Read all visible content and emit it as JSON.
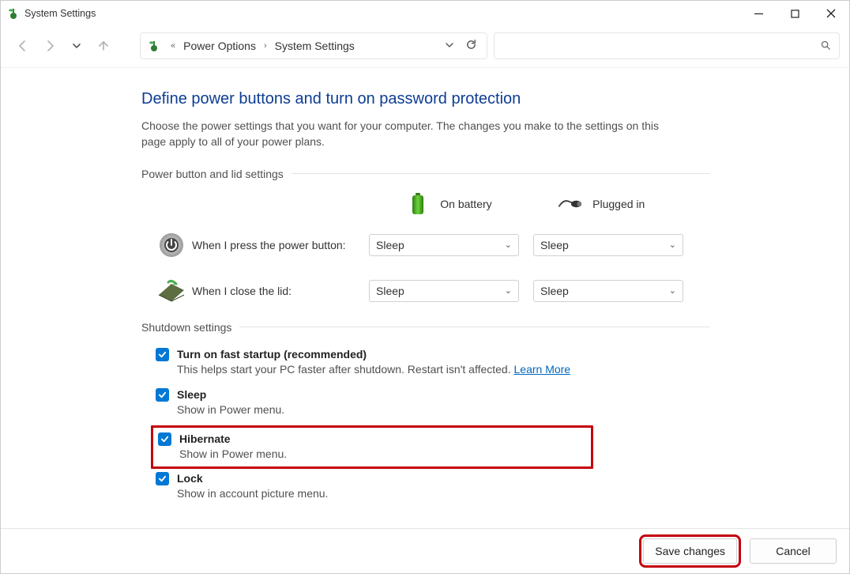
{
  "titlebar": {
    "title": "System Settings"
  },
  "breadcrumb": {
    "parent": "Power Options",
    "current": "System Settings"
  },
  "page": {
    "title": "Define power buttons and turn on password protection",
    "subtitle": "Choose the power settings that you want for your computer. The changes you make to the settings on this page apply to all of your power plans."
  },
  "power_section": {
    "header": "Power button and lid settings",
    "col_battery": "On battery",
    "col_plugged": "Plugged in",
    "rows": {
      "power_button": {
        "label": "When I press the power button:",
        "battery_value": "Sleep",
        "plugged_value": "Sleep"
      },
      "lid": {
        "label": "When I close the lid:",
        "battery_value": "Sleep",
        "plugged_value": "Sleep"
      }
    }
  },
  "shutdown_section": {
    "header": "Shutdown settings",
    "fast_startup": {
      "label": "Turn on fast startup (recommended)",
      "desc": "This helps start your PC faster after shutdown. Restart isn't affected. ",
      "link": "Learn More",
      "checked": true
    },
    "sleep": {
      "label": "Sleep",
      "desc": "Show in Power menu.",
      "checked": true
    },
    "hibernate": {
      "label": "Hibernate",
      "desc": "Show in Power menu.",
      "checked": true
    },
    "lock": {
      "label": "Lock",
      "desc": "Show in account picture menu.",
      "checked": true
    }
  },
  "footer": {
    "save": "Save changes",
    "cancel": "Cancel"
  }
}
